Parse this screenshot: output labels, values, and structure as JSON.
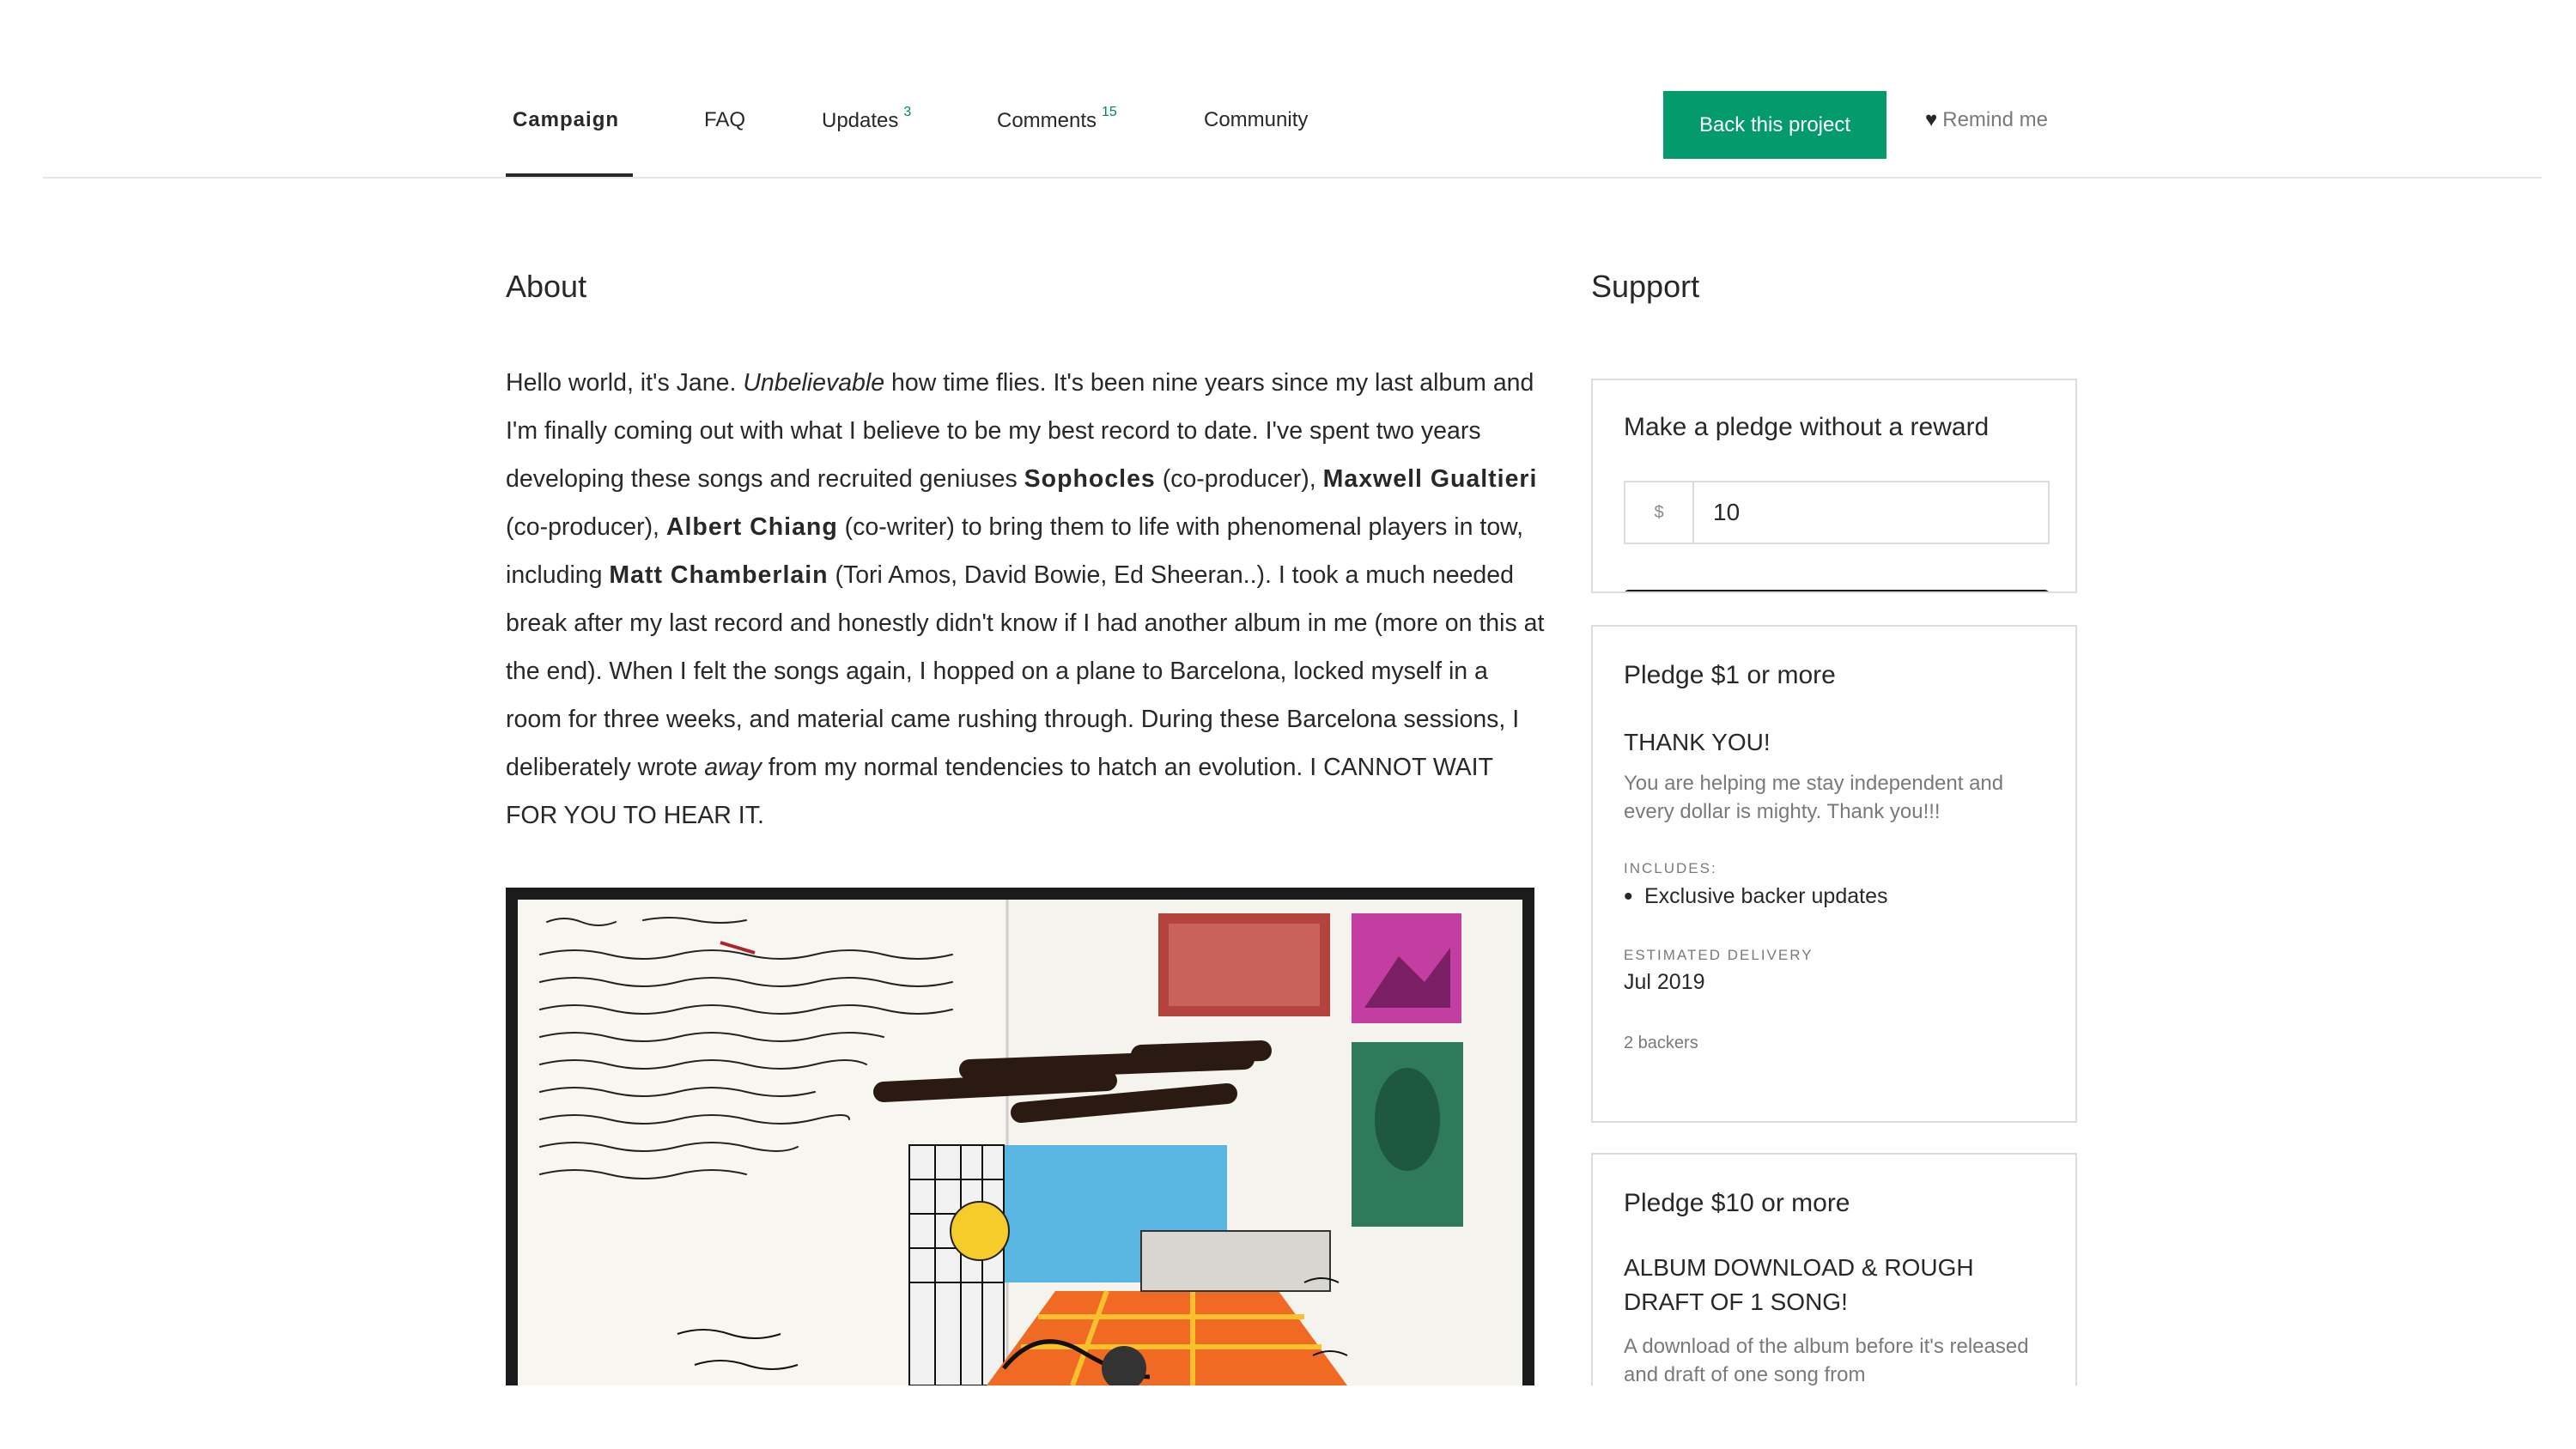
{
  "nav": {
    "tabs": [
      {
        "label": "Campaign",
        "count": ""
      },
      {
        "label": "FAQ",
        "count": ""
      },
      {
        "label": "Updates",
        "count": "3"
      },
      {
        "label": "Comments",
        "count": "15"
      },
      {
        "label": "Community",
        "count": ""
      }
    ],
    "back_button": "Back this project",
    "remind": "Remind me"
  },
  "about": {
    "heading": "About",
    "p1": "Hello world, it's Jane. ",
    "em1": "Unbelievable",
    "p2": " how time flies. It's been nine years since my last album and I'm finally coming out with what I believe to be my best record to date. I've spent two years developing these songs and recruited geniuses ",
    "b1": "Sophocles",
    "p3": " (co-producer), ",
    "b2": "Maxwell Gualtieri",
    "p4": " (co-producer), ",
    "b3": "Albert Chiang",
    "p5": " (co-writer) to bring them to life with phenomenal players in tow, including ",
    "b4": "Matt Chamberlain",
    "p6": " (Tori Amos, David Bowie, Ed Sheeran..). I took a much needed break after my last record and honestly didn't know if I had another album in me (more on this at the end). When I felt the songs again, I hopped on a plane to Barcelona, locked myself in a room for three weeks, and material came rushing through. During these Barcelona sessions, I deliberately wrote ",
    "em2": "away",
    "p7": " from my normal tendencies to hatch an evolution. I CANNOT WAIT FOR YOU TO HEAR IT."
  },
  "support": {
    "heading": "Support",
    "no_reward": {
      "title": "Make a pledge without a reward",
      "currency": "$",
      "amount": "10"
    },
    "rewards": [
      {
        "title": "Pledge $1 or more",
        "name": "THANK YOU!",
        "description": "You are helping me stay independent and every dollar is mighty. Thank you!!!",
        "includes_label": "INCLUDES:",
        "includes": [
          "Exclusive backer updates"
        ],
        "delivery_label": "ESTIMATED DELIVERY",
        "delivery": "Jul 2019",
        "backers": "2 backers"
      },
      {
        "title": "Pledge $10 or more",
        "name": "ALBUM DOWNLOAD & ROUGH DRAFT OF 1 SONG!",
        "description": "A download of the album before it's released and draft of one song from"
      }
    ]
  },
  "colors": {
    "accent": "#049b6c",
    "count": "#028858",
    "text": "#282828",
    "muted": "#7a7a7a",
    "border": "#dcdcdc"
  }
}
